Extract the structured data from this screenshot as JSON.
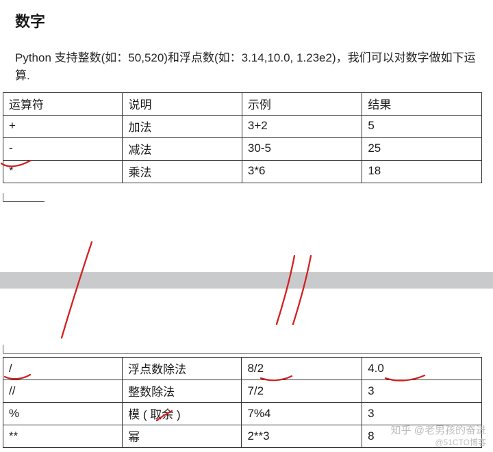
{
  "heading": "数字",
  "paragraph": "Python 支持整数(如：50,520)和浮点数(如：3.14,10.0, 1.23e2)，我们可以对数字做如下运算.",
  "table1": {
    "header": [
      "运算符",
      "说明",
      "示例",
      "结果"
    ],
    "rows": [
      [
        "+",
        "加法",
        "3+2",
        "5"
      ],
      [
        "-",
        "减法",
        "30-5",
        "25"
      ],
      [
        "*",
        "乘法",
        "3*6",
        "18"
      ]
    ]
  },
  "table2": {
    "rows": [
      [
        "/",
        "浮点数除法",
        "8/2",
        "4.0"
      ],
      [
        "//",
        "整数除法",
        "7/2",
        "3"
      ],
      [
        "%",
        "模 ( 取余 )",
        "7%4",
        "3"
      ],
      [
        "**",
        "幂",
        "2**3",
        "8"
      ]
    ]
  },
  "watermark": {
    "line1": "知乎 @老男孩的奋进",
    "line2": "@51CTO博客"
  }
}
